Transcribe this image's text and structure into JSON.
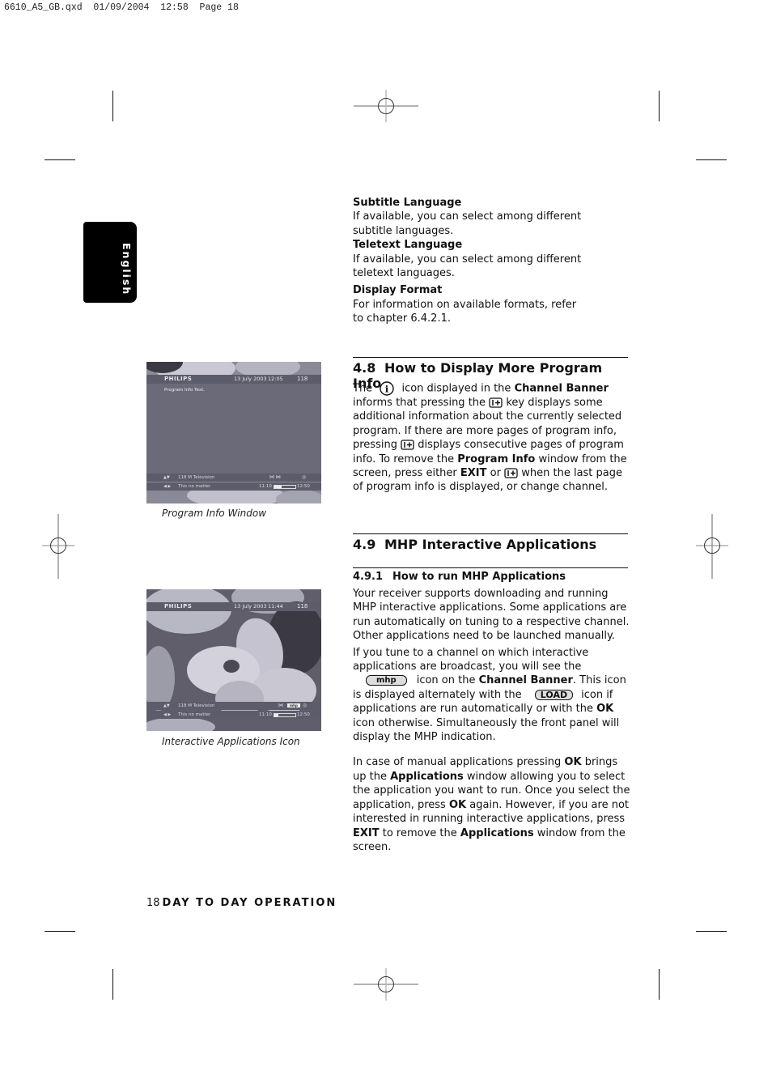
{
  "slug": "6610_A5_GB.qxd  01/09/2004  12:58  Page 18",
  "language_tab": "English",
  "top_entries": [
    {
      "heading": "Subtitle Language",
      "body": "If available, you can select among different subtitle languages."
    },
    {
      "heading": "Teletext Language",
      "body": "If available, you can select among different teletext languages."
    },
    {
      "heading": "Display Format",
      "body": "For information on available formats, refer to chapter 6.4.2.1."
    }
  ],
  "section_48": {
    "number": "4.8",
    "title": "How to Display More Program Info",
    "p1": "The",
    "p2": "icon displayed in the",
    "p3": "Channel Banner",
    "p4": "informs that pressing the",
    "p5": "key displays some additional information about the currently selected program. If there are more pages of program info, pressing",
    "p6": "displays consecutive pages of program info. To remove the",
    "p7": "Program Info",
    "p8": "window from the screen, press either",
    "p9": "EXIT",
    "p10": "or",
    "p11": "when the last page of program info is displayed, or change channel."
  },
  "section_49": {
    "number": "4.9",
    "title": "MHP Interactive Applications",
    "sub_number": "4.9.1",
    "sub_title": "How to run MHP Applications",
    "para1": "Your receiver supports downloading and running MHP interactive applications. Some applications are run automatically on tuning to a respective channel. Other applications need to be launched manually.",
    "para2": {
      "a": "If you tune to a channel on which interactive applications are broadcast, you will see the",
      "mhp_icon": "mhp",
      "b": "icon on the",
      "c": "Channel Banner",
      "d": ". This icon is displayed alternately with the",
      "load_icon": "LOAD",
      "e": "icon if applications are run automatically or with the",
      "f": "OK",
      "g": "icon otherwise. Simultaneously the front panel will display the MHP indication."
    },
    "para3": {
      "a": "In case of manual applications pressing",
      "b": "OK",
      "c": "brings up the",
      "d": "Applications",
      "e": "window allowing you to select the application you want to run. Once you select the application, press",
      "f": "OK",
      "g": "again. However, if you are not interested in running interactive applications, press",
      "h": "EXIT",
      "i": "to remove the",
      "j": "Applications",
      "k": "window from the screen."
    }
  },
  "screens": [
    {
      "caption": "Program Info Window",
      "brand": "PHILIPS",
      "date": "13 July 2003",
      "time": "12:05",
      "channel": "118",
      "info_text": "Program Info Text.",
      "row1": "118 M Television",
      "row2": "This no matter",
      "start": "11:10",
      "end": "12:50",
      "progress": 0.35
    },
    {
      "caption": "Interactive Applications Icon",
      "brand": "PHILIPS",
      "date": "13 July 2003",
      "time": "11:44",
      "channel": "118",
      "row1": "118 M Television",
      "row2": "This no matter",
      "start": "11:10",
      "end": "12:50",
      "progress": 0.2,
      "badge": "mhp"
    }
  ],
  "footer": {
    "page_number": "18",
    "section": "DAY TO DAY OPERATION"
  }
}
